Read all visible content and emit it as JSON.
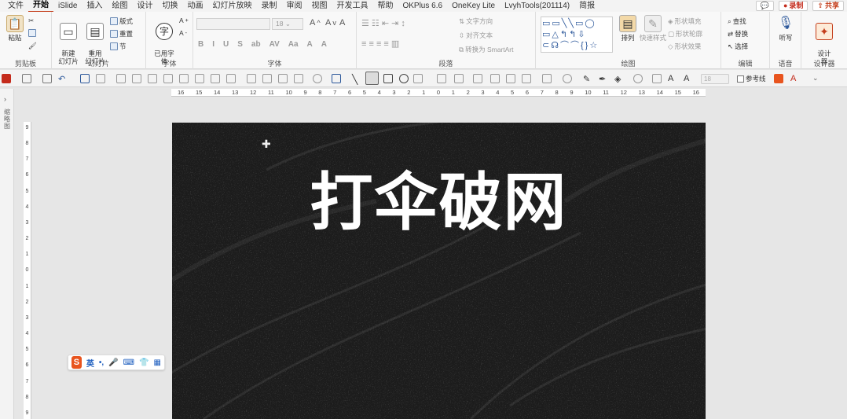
{
  "tabs": [
    "文件",
    "开始",
    "iSlide",
    "插入",
    "绘图",
    "设计",
    "切换",
    "动画",
    "幻灯片放映",
    "录制",
    "审阅",
    "视图",
    "开发工具",
    "帮助",
    "OKPlus 6.6",
    "OneKey Lite",
    "LvyhTools(201114)",
    "简报"
  ],
  "active_tab": "开始",
  "top_right": {
    "record": "录制",
    "share": "共享"
  },
  "ribbon": {
    "clipboard": {
      "label": "剪贴板",
      "paste": "粘贴"
    },
    "slides": {
      "label": "幻灯片",
      "new_slide": "新建\n幻灯片",
      "reuse": "重用\n幻灯片",
      "layout": "版式",
      "reset": "重置",
      "section": "节"
    },
    "font_convert": {
      "label": "字体",
      "btn": "已用字\n体"
    },
    "font": {
      "label": "字体",
      "size": "18",
      "row2": [
        "B",
        "I",
        "U",
        "S",
        "ab",
        "AV",
        "Aa",
        "A",
        "A"
      ]
    },
    "paragraph": {
      "label": "段落",
      "text_dir": "文字方向",
      "align_text": "对齐文本",
      "smartart": "转换为 SmartArt"
    },
    "drawing": {
      "label": "绘图",
      "arrange": "排列",
      "quick_styles": "快速样式",
      "fill": "形状填充",
      "outline": "形状轮廓",
      "effects": "形状效果"
    },
    "editing": {
      "label": "编辑",
      "find": "查找",
      "replace": "替换",
      "select": "选择"
    },
    "voice": {
      "label": "语音",
      "dictate": "听写"
    },
    "designer": {
      "label": "设计器",
      "btn": "设计\n器"
    }
  },
  "qbar": {
    "font_size": "18",
    "guides": "参考线"
  },
  "ruler_ticks": [
    "16",
    "15",
    "14",
    "13",
    "12",
    "11",
    "10",
    "9",
    "8",
    "7",
    "6",
    "5",
    "4",
    "3",
    "2",
    "1",
    "0",
    "1",
    "2",
    "3",
    "4",
    "5",
    "6",
    "7",
    "8",
    "9",
    "10",
    "11",
    "12",
    "13",
    "14",
    "15",
    "16"
  ],
  "vruler_ticks": [
    "9",
    "8",
    "7",
    "6",
    "5",
    "4",
    "3",
    "2",
    "1",
    "0",
    "1",
    "2",
    "3",
    "4",
    "5",
    "6",
    "7",
    "8",
    "9"
  ],
  "left_pane": {
    "arrow": "›",
    "label": "缩略图"
  },
  "slide": {
    "title": "打伞破网",
    "background": "#202020",
    "text_color": "#ffffff"
  },
  "ime": {
    "mode": "英",
    "punct": "•,",
    "mic": "🎤",
    "kbd": "⌨",
    "skin": "👕",
    "grid": "▦"
  },
  "colors": {
    "accent": "#c43e1c",
    "ribbon_bg": "#f8f8f8"
  }
}
